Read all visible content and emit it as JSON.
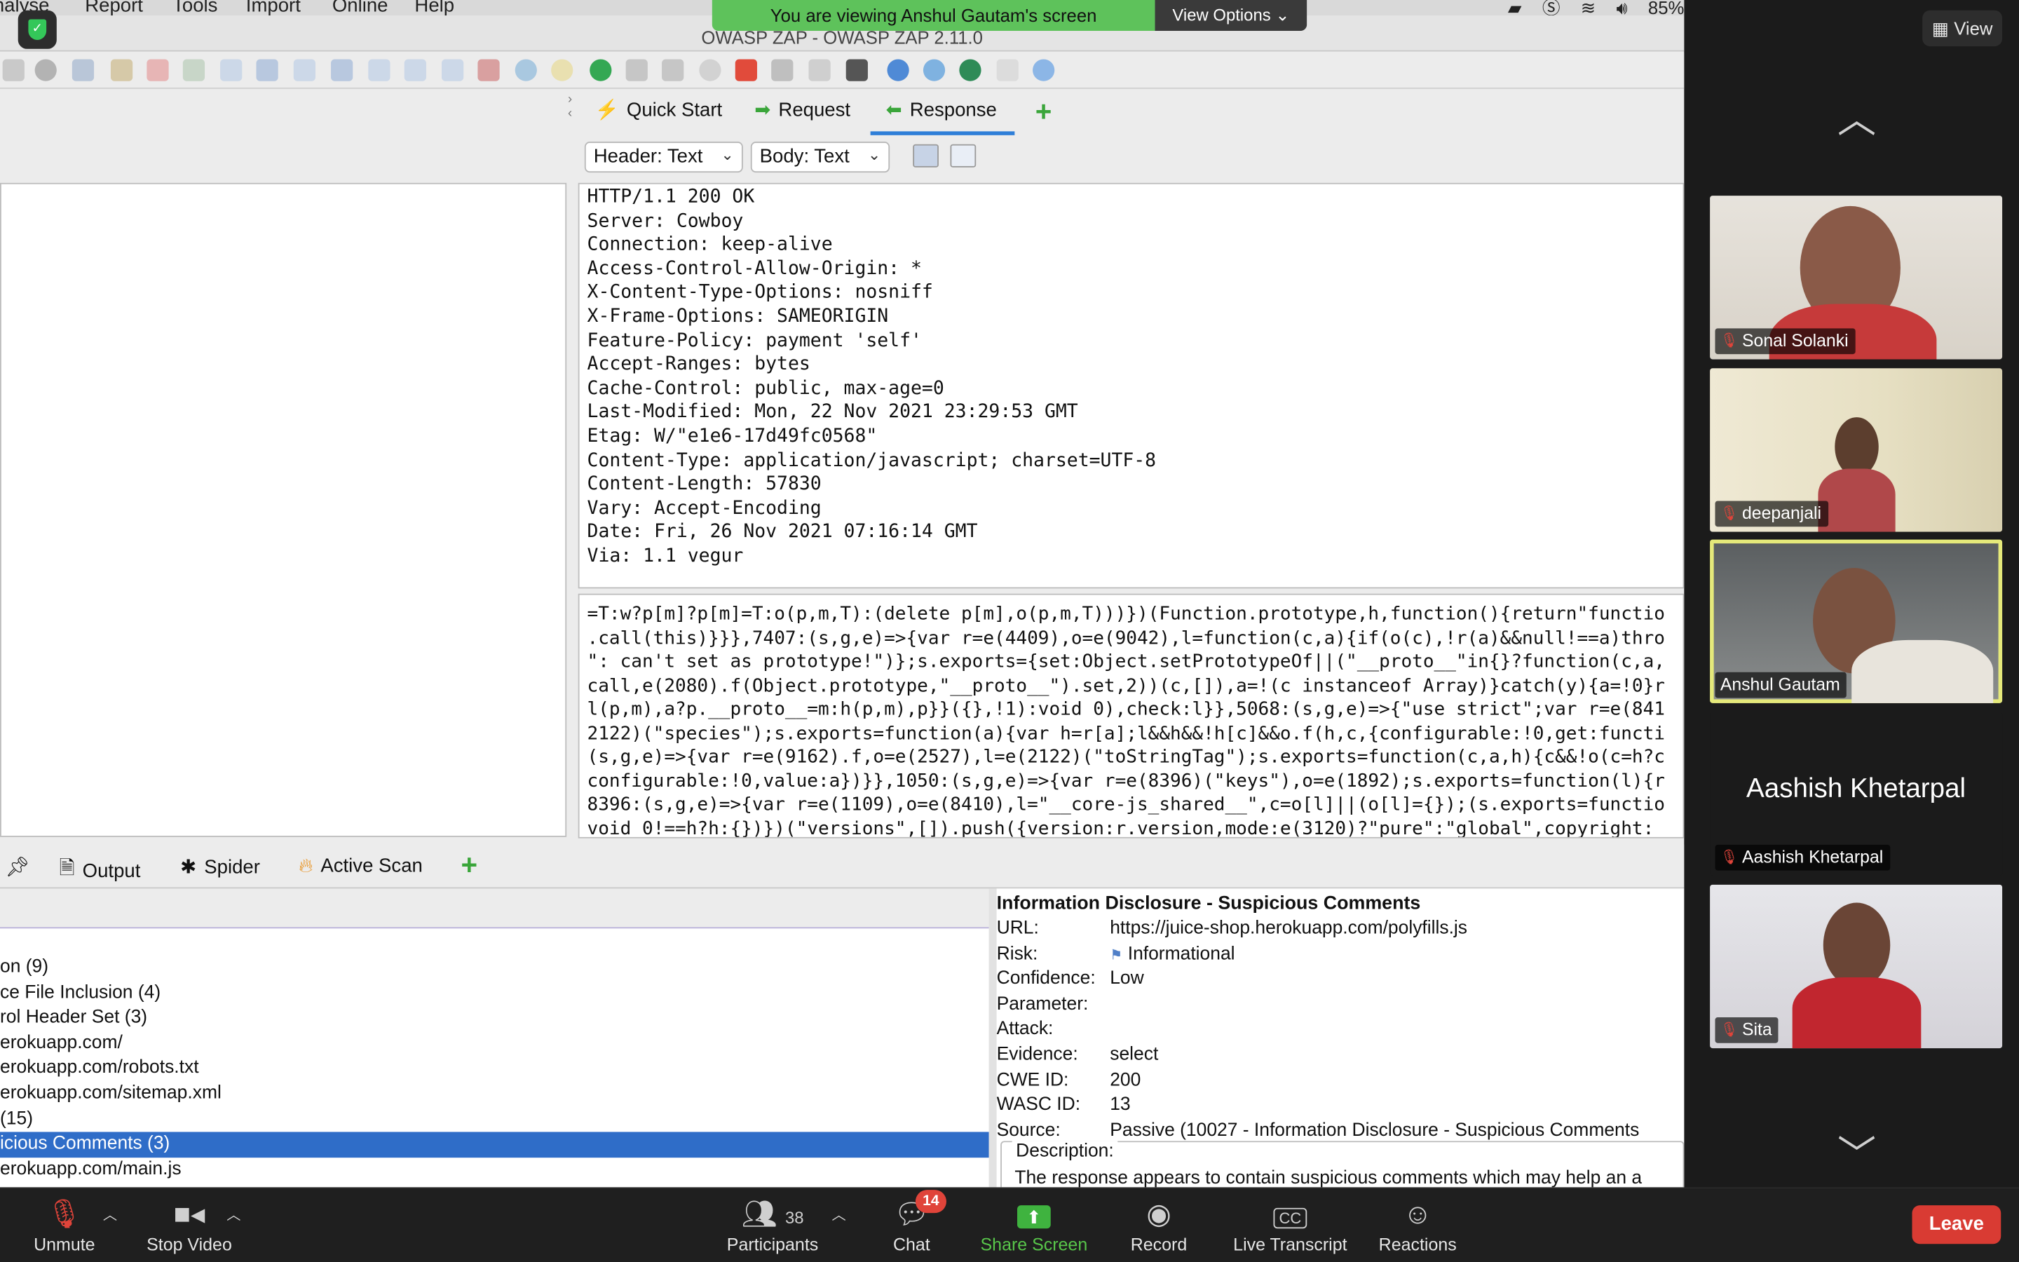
{
  "menubar": {
    "items": [
      "nalyse",
      "Report",
      "Tools",
      "Import",
      "Online",
      "Help"
    ],
    "battery": "85%"
  },
  "window": {
    "title": "OWASP ZAP - OWASP ZAP 2.11.0"
  },
  "share_banner": {
    "message": "You are viewing Anshul Gautam's screen",
    "options_label": "View Options"
  },
  "req_tabs": {
    "quick_start": "Quick Start",
    "request": "Request",
    "response": "Response"
  },
  "view_controls": {
    "header_select": "Header: Text",
    "body_select": "Body: Text"
  },
  "response_headers": [
    "HTTP/1.1 200 OK",
    "Server: Cowboy",
    "Connection: keep-alive",
    "Access-Control-Allow-Origin: *",
    "X-Content-Type-Options: nosniff",
    "X-Frame-Options: SAMEORIGIN",
    "Feature-Policy: payment 'self'",
    "Accept-Ranges: bytes",
    "Cache-Control: public, max-age=0",
    "Last-Modified: Mon, 22 Nov 2021 23:29:53 GMT",
    "Etag: W/\"e1e6-17d49fc0568\"",
    "Content-Type: application/javascript; charset=UTF-8",
    "Content-Length: 57830",
    "Vary: Accept-Encoding",
    "Date: Fri, 26 Nov 2021 07:16:14 GMT",
    "Via: 1.1 vegur"
  ],
  "response_body_lines": [
    "=T:w?p[m]?p[m]=T:o(p,m,T):(delete p[m],o(p,m,T)))})(Function.prototype,h,function(){return\"functio",
    ".call(this)}}},7407:(s,g,e)=>{var r=e(4409),o=e(9042),l=function(c,a){if(o(c),!r(a)&&null!==a)thro",
    "\": can't set as prototype!\")};s.exports={set:Object.setPrototypeOf||(\"__proto__\"in{}?function(c,a,",
    "call,e(2080).f(Object.prototype,\"__proto__\").set,2))(c,[]),a=!(c instanceof Array)}catch(y){a=!0}r",
    "l(p,m),a?p.__proto__=m:h(p,m),p}}({},!1):void 0),check:l}},5068:(s,g,e)=>{\"use strict\";var r=e(841",
    "2122)(\"species\");s.exports=function(a){var h=r[a];l&&h&&!h[c]&&o.f(h,c,{configurable:!0,get:functi",
    "(s,g,e)=>{var r=e(9162).f,o=e(2527),l=e(2122)(\"toStringTag\");s.exports=function(c,a,h){c&&!o(c=h?c",
    "configurable:!0,value:a})}},1050:(s,g,e)=>{var r=e(8396)(\"keys\"),o=e(1892);s.exports=function(l){r",
    "8396:(s,g,e)=>{var r=e(1109),o=e(8410),l=\"__core-js_shared__\",c=o[l]||(o[l]={});(s.exports=functio",
    "void 0!==h?h:{})})(\"versions\",[]).push({version:r.version,mode:e(3120)?\"pure\":\"global\",copyright:"
  ],
  "bottom_tabs": {
    "output": "Output",
    "spider": "Spider",
    "active_scan": "Active Scan"
  },
  "alerts_tree": [
    "on (9)",
    "ce File Inclusion (4)",
    "rol Header Set (3)",
    "erokuapp.com/",
    "erokuapp.com/robots.txt",
    "erokuapp.com/sitemap.xml",
    "(15)",
    "icious Comments (3)",
    "erokuapp.com/main.js"
  ],
  "alert_detail": {
    "title": "Information Disclosure - Suspicious Comments",
    "fields": [
      {
        "label": "URL:",
        "value": "https://juice-shop.herokuapp.com/polyfills.js"
      },
      {
        "label": "Risk:",
        "value": "Informational"
      },
      {
        "label": "Confidence:",
        "value": "Low"
      },
      {
        "label": "Parameter:",
        "value": ""
      },
      {
        "label": "Attack:",
        "value": ""
      },
      {
        "label": "Evidence:",
        "value": "select"
      },
      {
        "label": "CWE ID:",
        "value": "200"
      },
      {
        "label": "WASC ID:",
        "value": "13"
      },
      {
        "label": "Source:",
        "value": "Passive (10027 - Information Disclosure - Suspicious Comments"
      }
    ],
    "description_label": "Description:",
    "description_text": "The response appears to contain suspicious comments which may help an a"
  },
  "sidebar": {
    "view_label": "View",
    "participants": [
      {
        "name": "Sonal Solanki"
      },
      {
        "name": "deepanjali"
      },
      {
        "name": "Anshul Gautam"
      },
      {
        "name": "Aashish Khetarpal"
      },
      {
        "name": "Sita"
      }
    ]
  },
  "controls": {
    "unmute": "Unmute",
    "stop_video": "Stop Video",
    "participants": "Participants",
    "participants_count": "38",
    "chat": "Chat",
    "chat_badge": "14",
    "share_screen": "Share Screen",
    "record": "Record",
    "live_transcript": "Live Transcript",
    "reactions": "Reactions",
    "leave": "Leave"
  },
  "colors": {
    "selection_blue": "#2f6dc8",
    "share_green": "#5ec25b",
    "leave_red": "#d93b33",
    "active_speaker": "#e5e97a"
  }
}
